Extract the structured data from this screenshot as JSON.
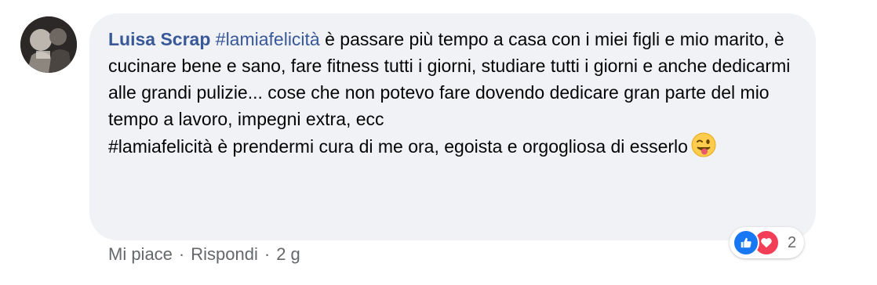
{
  "comment": {
    "author": "Luisa Scrap",
    "hashtag_1": "#lamiafelicità",
    "text_1": " è passare più tempo a casa con i miei figli e mio marito, è cucinare bene e sano, fare fitness tutti i giorni, studiare tutti i giorni e anche dedicarmi alle grandi pulizie... cose che non potevo fare dovendo dedicare gran parte del mio tempo a lavoro, impegni extra, ecc",
    "line_2": "#lamiafelicità è prendermi cura di me ora, egoista e orgogliosa di esserlo"
  },
  "reactions": {
    "icons": [
      "like-icon",
      "love-icon"
    ],
    "count": "2"
  },
  "actions": {
    "like_label": "Mi piace",
    "reply_label": "Rispondi",
    "separator": "·",
    "timestamp": "2 g"
  },
  "colors": {
    "author": "#385898",
    "bubble": "#f0f2f5",
    "meta": "#65676b",
    "like": "#1877f2",
    "love": "#f33e58"
  }
}
